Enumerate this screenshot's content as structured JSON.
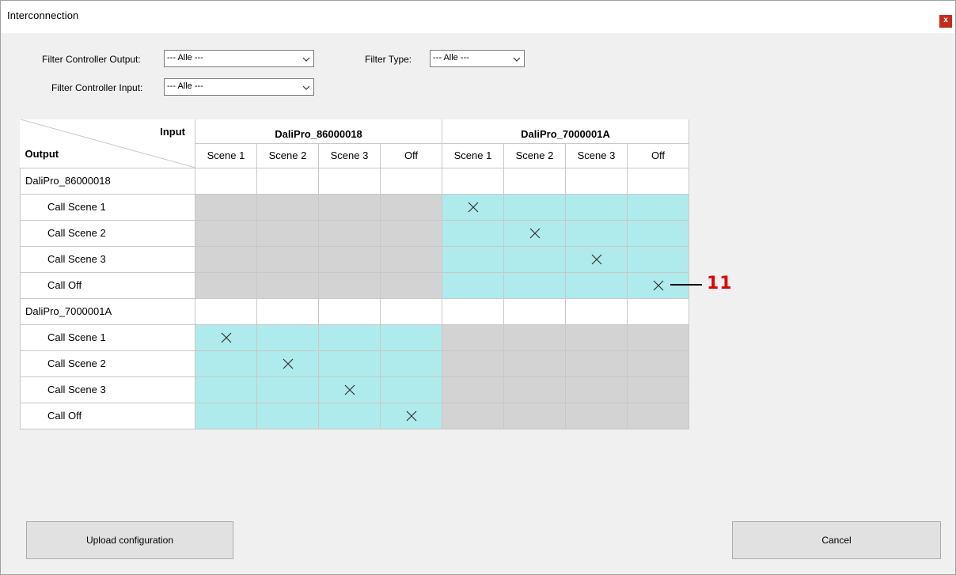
{
  "window": {
    "title": "Interconnection",
    "close_label": "x"
  },
  "filters": {
    "output_label": "Filter Controller Output:",
    "output_value": "--- Alle ---",
    "input_label": "Filter Controller Input:",
    "input_value": "--- Alle ---",
    "type_label": "Filter Type:",
    "type_value": "--- Alle ---"
  },
  "matrix": {
    "corner_input": "Input",
    "corner_output": "Output",
    "input_groups": [
      {
        "name": "DaliPro_86000018",
        "columns": [
          "Scene 1",
          "Scene 2",
          "Scene 3",
          "Off"
        ]
      },
      {
        "name": "DaliPro_7000001A",
        "columns": [
          "Scene 1",
          "Scene 2",
          "Scene 3",
          "Off"
        ]
      }
    ],
    "output_groups": [
      {
        "name": "DaliPro_86000018",
        "rows": [
          "Call Scene 1",
          "Call Scene 2",
          "Call Scene 3",
          "Call Off"
        ]
      },
      {
        "name": "DaliPro_7000001A",
        "rows": [
          "Call Scene 1",
          "Call Scene 2",
          "Call Scene 3",
          "Call Off"
        ]
      }
    ],
    "connections": [
      {
        "output_group": 0,
        "row": 0,
        "input_group": 1,
        "column": 0
      },
      {
        "output_group": 0,
        "row": 1,
        "input_group": 1,
        "column": 1
      },
      {
        "output_group": 0,
        "row": 2,
        "input_group": 1,
        "column": 2
      },
      {
        "output_group": 0,
        "row": 3,
        "input_group": 1,
        "column": 3
      },
      {
        "output_group": 1,
        "row": 0,
        "input_group": 0,
        "column": 0
      },
      {
        "output_group": 1,
        "row": 1,
        "input_group": 0,
        "column": 1
      },
      {
        "output_group": 1,
        "row": 2,
        "input_group": 0,
        "column": 2
      },
      {
        "output_group": 1,
        "row": 3,
        "input_group": 0,
        "column": 3
      }
    ],
    "colors": {
      "same_device": "#d3d3d3",
      "cross_device": "#afeaec"
    }
  },
  "annotation": {
    "number": "11",
    "color": "#e00000"
  },
  "buttons": {
    "upload_label": "Upload configuration",
    "cancel_label": "Cancel"
  }
}
